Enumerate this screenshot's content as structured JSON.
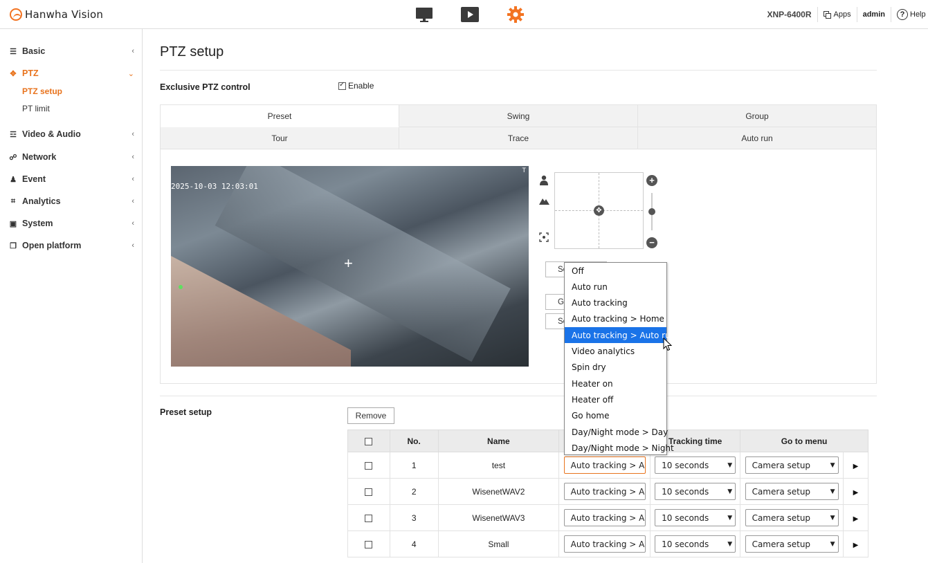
{
  "header": {
    "logo_text": "Hanwha Vision",
    "model": "XNP-6400R",
    "apps_label": "Apps",
    "user": "admin",
    "help_label": "Help",
    "icons": [
      "monitor-icon",
      "play-icon",
      "gear-icon"
    ],
    "accent_color": "#f37321"
  },
  "sidebar": {
    "items": [
      {
        "label": "Basic",
        "icon": "list-icon"
      },
      {
        "label": "PTZ",
        "icon": "move-icon",
        "sub": [
          "PTZ setup",
          "PT limit"
        ],
        "active_sub": "PTZ setup"
      },
      {
        "label": "Video & Audio",
        "icon": "sliders-icon"
      },
      {
        "label": "Network",
        "icon": "network-icon"
      },
      {
        "label": "Event",
        "icon": "bell-icon"
      },
      {
        "label": "Analytics",
        "icon": "frame-icon"
      },
      {
        "label": "System",
        "icon": "system-icon"
      },
      {
        "label": "Open platform",
        "icon": "platform-icon"
      }
    ]
  },
  "main": {
    "title": "PTZ setup",
    "exclusive_label": "Exclusive PTZ control",
    "enable_label": "Enable",
    "enable_checked": true,
    "tabs_row1": [
      "Preset",
      "Swing",
      "Group"
    ],
    "tabs_row2": [
      "Tour",
      "Trace",
      "Auto run"
    ],
    "active_tab": "Preset",
    "video_timestamp": "2025-10-03 12:03:01",
    "video_corner": "T",
    "buttons": [
      "Se",
      "G",
      "Se"
    ]
  },
  "dropdown": {
    "options": [
      "Off",
      "Auto run",
      "Auto tracking",
      "Auto tracking > Home",
      "Auto tracking > Auto run",
      "Video analytics",
      "Spin dry",
      "Heater on",
      "Heater off",
      "Go home",
      "Day/Night mode > Day",
      "Day/Night mode > Night"
    ],
    "highlighted": "Auto tracking > Auto run"
  },
  "preset": {
    "section_label": "Preset setup",
    "remove_label": "Remove",
    "headers": {
      "no": "No.",
      "name": "Name",
      "tracking_time": "Tracking time",
      "go_to_menu": "Go to menu"
    },
    "rows": [
      {
        "no": "1",
        "name": "test",
        "action": "Auto tracking > A",
        "tracking": "10 seconds",
        "menu": "Camera setup"
      },
      {
        "no": "2",
        "name": "WisenetWAV2",
        "action": "Auto tracking > A",
        "tracking": "10 seconds",
        "menu": "Camera setup"
      },
      {
        "no": "3",
        "name": "WisenetWAV3",
        "action": "Auto tracking > A",
        "tracking": "10 seconds",
        "menu": "Camera setup"
      },
      {
        "no": "4",
        "name": "Small",
        "action": "Auto tracking > A",
        "tracking": "10 seconds",
        "menu": "Camera setup"
      }
    ]
  }
}
